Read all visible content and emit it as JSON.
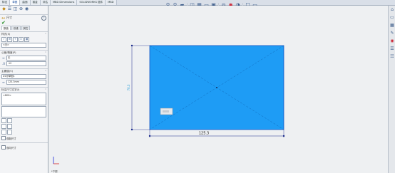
{
  "tabs": [
    "特征",
    "草图",
    "曲面",
    "钣金",
    "评估",
    "MBD Dimensions",
    "SOLIDWORKS 插件",
    "MBD"
  ],
  "active_tab": 1,
  "hud_icons": [
    "search-icon",
    "zoom-fit-icon",
    "zoom-area-icon",
    "previous-view-icon",
    "section-view-icon",
    "view-orientation-icon",
    "display-style-icon",
    "hide-show-icon",
    "appearance-icon",
    "scene-icon",
    "view-settings-icon",
    "monitor-icon"
  ],
  "property_manager": {
    "title": "尺寸",
    "sub_tabs": [
      "数值",
      "引线",
      "其它"
    ],
    "style_section": "样式(S)",
    "style_field": "<无>",
    "tolerance_section": "公差/精度(P)",
    "tol_field_1": "无",
    "tol_field_2": ".12",
    "primary_section": "主要值(V)",
    "primary_field_1": "D1@草图1",
    "primary_field_2": "125.3mm",
    "dim_text_section": "标注尺寸文字(I)",
    "dim_text_value": "<DIM>",
    "dual_dim": "双制尺寸",
    "two_way": "双向尺寸"
  },
  "drawing": {
    "horizontal_dim": "125.3",
    "vertical_dim": "70.3",
    "rect_fill": "#1e9cf5",
    "dim_color": "#1a2a8a",
    "arrow_color": "#d42020"
  },
  "status_text": "*下视",
  "right_icons": [
    "home-icon",
    "parts-icon",
    "file-explorer-icon",
    "view-palette-icon",
    "appearance-icon",
    "custom-props-icon",
    "resources-icon"
  ]
}
